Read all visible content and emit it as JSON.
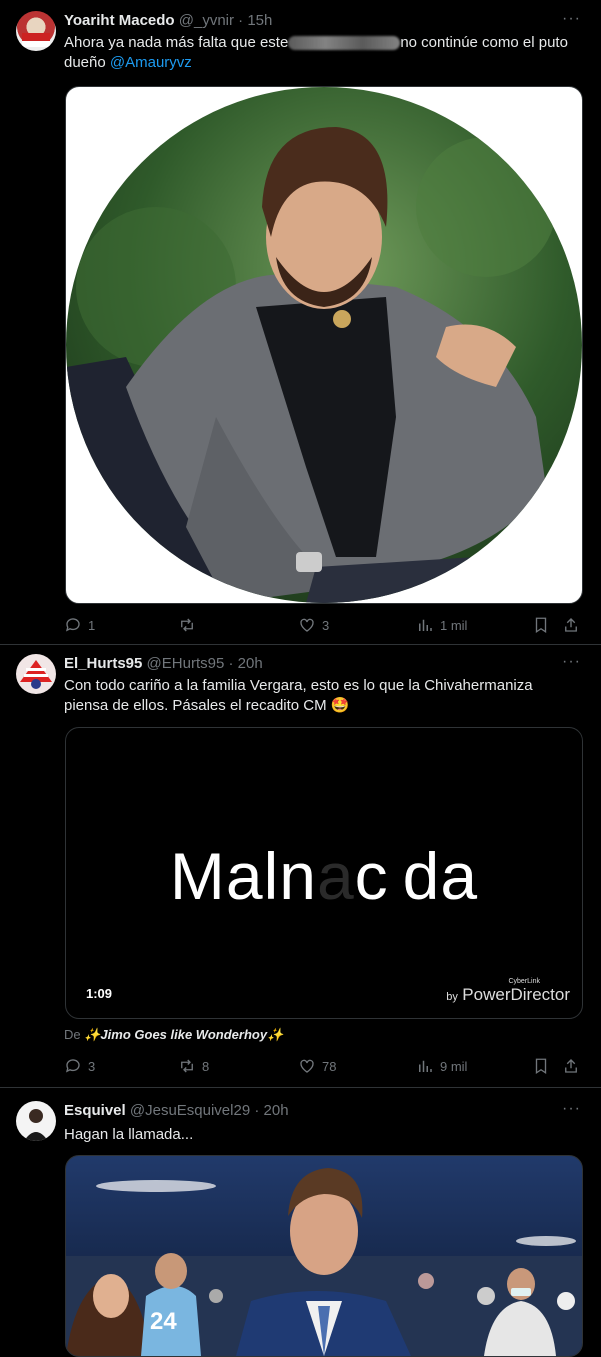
{
  "tweets": [
    {
      "name": "Yoariht Macedo",
      "handle": "@_yvnir",
      "time": "15h",
      "text_before": "Ahora ya nada más falta que este",
      "text_after": "no continúe como el puto dueño",
      "mention": "@Amauryvz",
      "replies": "1",
      "retweets": "",
      "likes": "3",
      "views": "1 mil"
    },
    {
      "name": "El_Hurts95",
      "handle": "@EHurts95",
      "time": "20h",
      "text": "Con todo cariño a la familia Vergara, esto es lo que la Chivahermaniza piensa de ellos. Pásales el recadito CM 🤩",
      "video_text_left": "Maln",
      "video_text_mid1": "a",
      "video_text_mid2": "c",
      "video_text_right": "da",
      "video_duration": "1:09",
      "watermark_by": "by",
      "watermark_brand": "PowerDirector",
      "watermark_small": "CyberLink",
      "via_label": "De",
      "via_source": "✨Jimo Goes like Wonderhoy✨",
      "replies": "3",
      "retweets": "8",
      "likes": "78",
      "views": "9 mil"
    },
    {
      "name": "Esquivel",
      "handle": "@JesuEsquivel29",
      "time": "20h",
      "text": "Hagan la llamada...",
      "jersey_number": "24"
    }
  ],
  "separator": "·",
  "more_glyph": "···",
  "colors": {
    "accent": "#1d9bf0",
    "muted": "#71767b",
    "border": "#2f3336"
  },
  "icons": [
    "reply-icon",
    "retweet-icon",
    "like-icon",
    "views-icon",
    "bookmark-icon",
    "share-icon",
    "more-icon"
  ]
}
